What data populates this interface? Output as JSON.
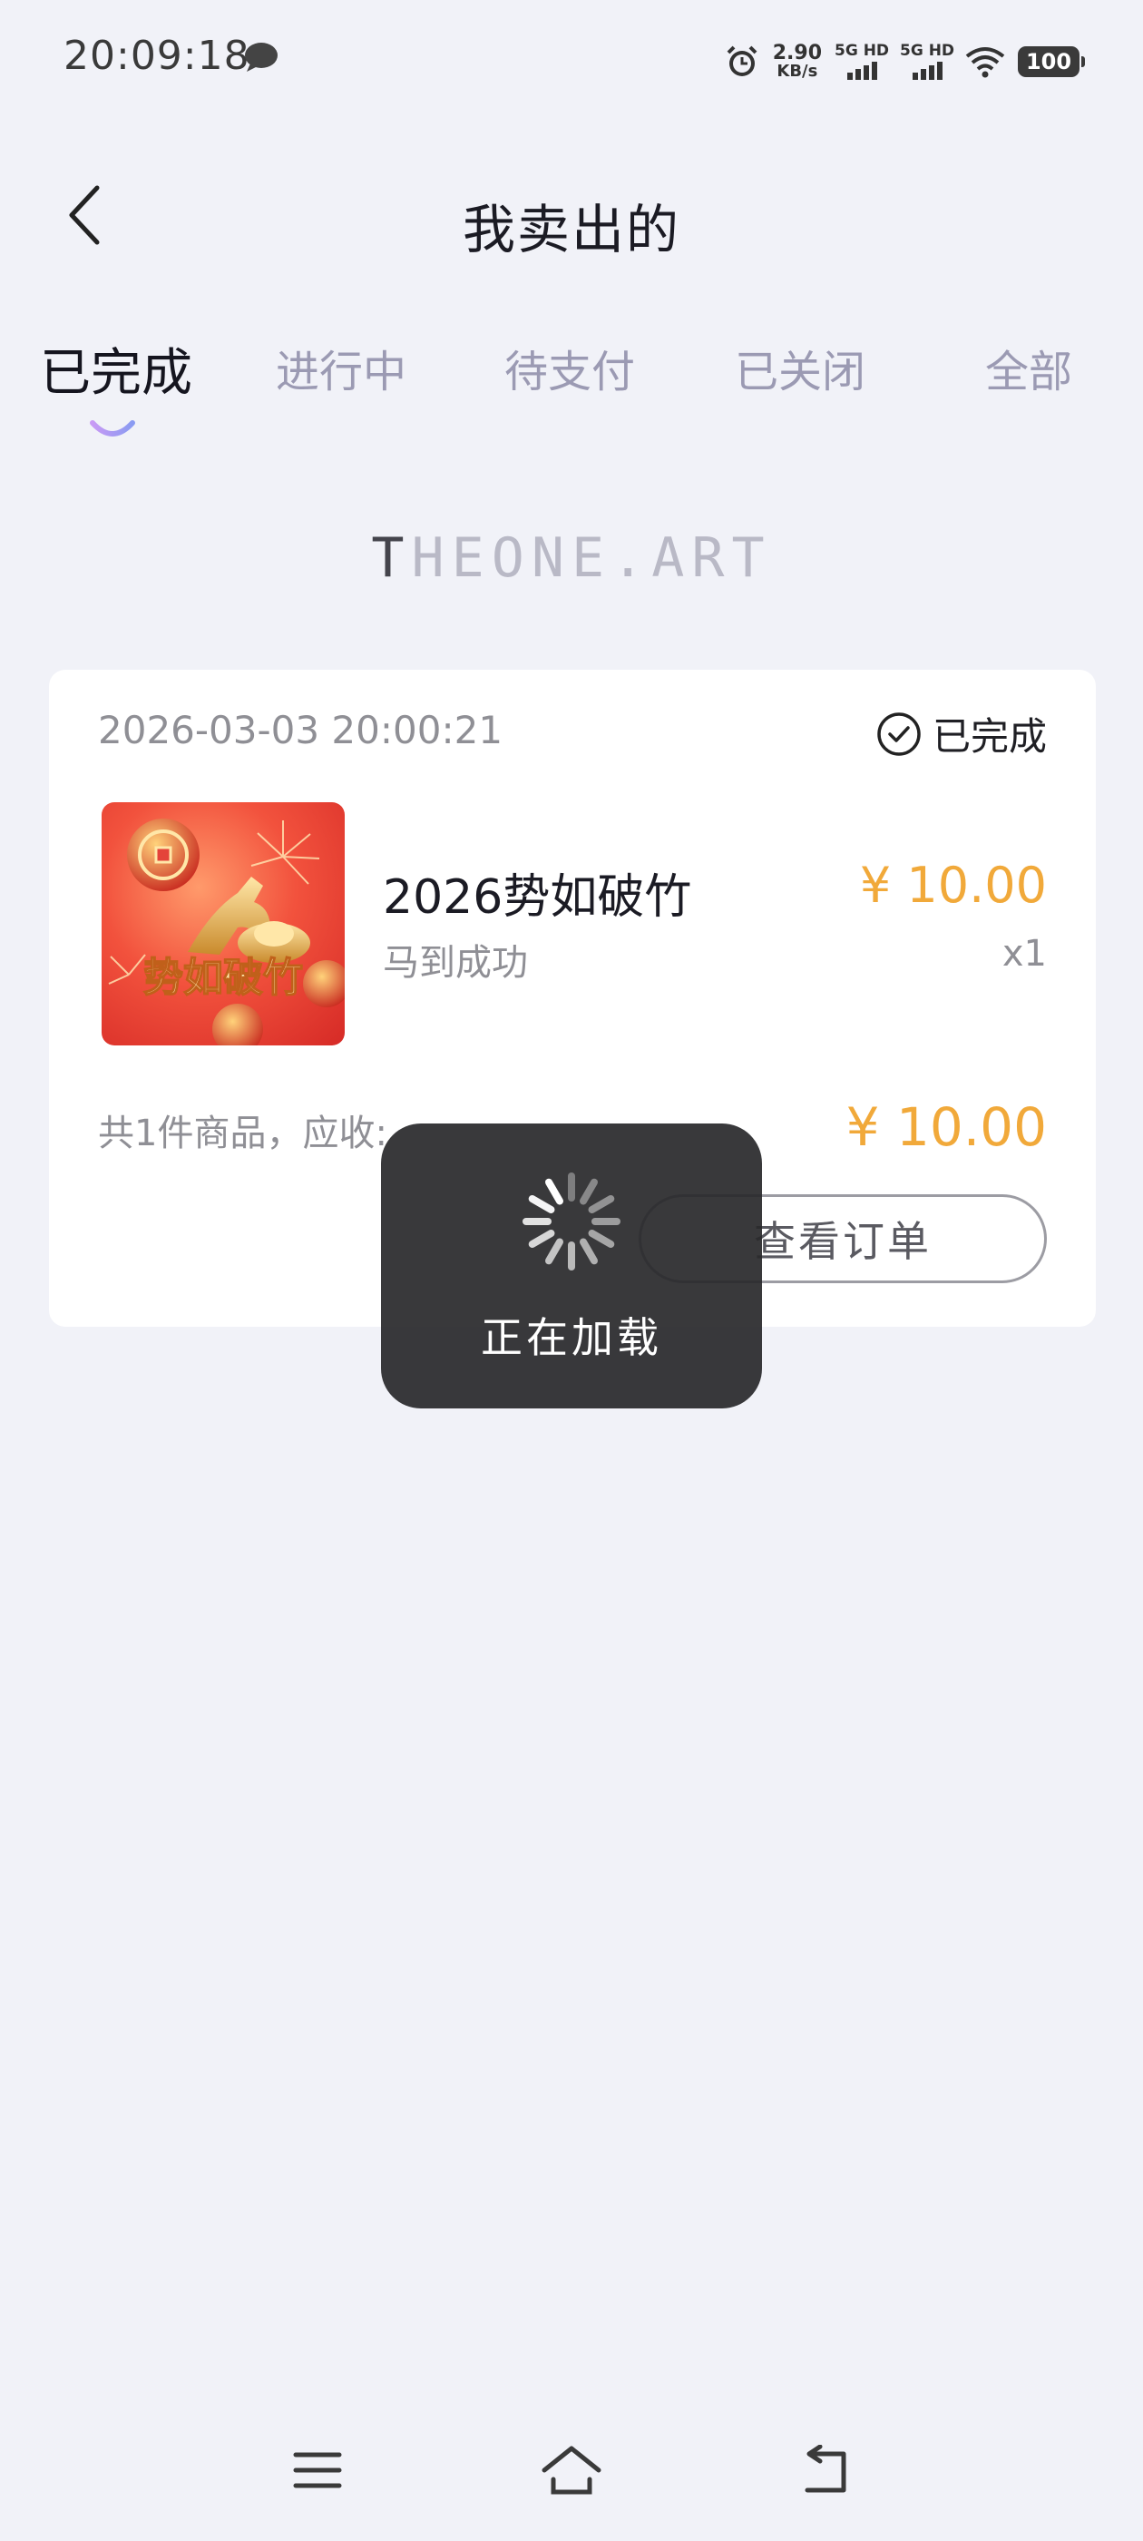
{
  "status_bar": {
    "time": "20:09:18",
    "net_speed_value": "2.90",
    "net_speed_unit": "KB/s",
    "sim1_label": "5G HD",
    "sim2_label": "5G HD",
    "battery": "100",
    "icons": [
      "chat-bubble-icon",
      "alarm-icon",
      "signal-icon",
      "wifi-icon",
      "battery-icon"
    ]
  },
  "header": {
    "title": "我卖出的",
    "back_icon": "chevron-left-icon"
  },
  "tabs": [
    {
      "label": "已完成",
      "active": true
    },
    {
      "label": "进行中",
      "active": false
    },
    {
      "label": "待支付",
      "active": false
    },
    {
      "label": "已关闭",
      "active": false
    },
    {
      "label": "全部",
      "active": false
    }
  ],
  "brand": {
    "strong": "T",
    "rest": "HEONE.ART"
  },
  "order": {
    "datetime": "2026-03-03 20:00:21",
    "status": "已完成",
    "product": {
      "image_text": "势如破竹",
      "name": "2026势如破竹",
      "subtitle": "马到成功",
      "price": "¥ 10.00",
      "quantity": "x1"
    },
    "summary_label": "共1件商品，应收:",
    "total": "¥ 10.00",
    "view_button": "查看订单"
  },
  "loading": {
    "text": "正在加载"
  },
  "nav": {
    "icons": [
      "menu-icon",
      "home-icon",
      "back-nav-icon"
    ]
  },
  "colors": {
    "background": "#f1f2f8",
    "accent_price": "#f1a93a",
    "tab_indicator": "#a98cf0",
    "toast_bg": "#28282a"
  }
}
